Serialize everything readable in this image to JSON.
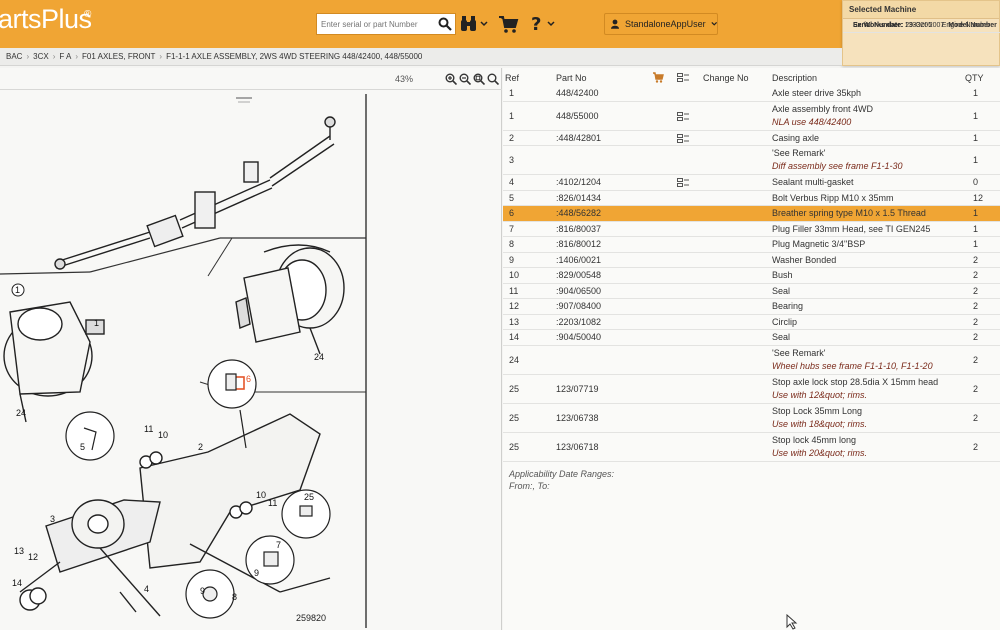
{
  "header": {
    "logo": "artsPlus",
    "search_placeholder": "Enter serial or part Number",
    "user_name": "StandaloneAppUser"
  },
  "machine": {
    "title": "Selected Machine",
    "serial_label": "Serial Number:",
    "serial_value": "1333205",
    "engine_label": "Engine Number",
    "works_label": "Ex Works date:",
    "works_value": "29-Oct-2007",
    "model_label": "Model Number"
  },
  "breadcrumb": [
    "BAC",
    "3CX",
    "F A",
    "F01 AXLES, FRONT",
    "F1-1-1 AXLE ASSEMBLY, 2WS 4WD STEERING 448/42400, 448/55000"
  ],
  "drawing": {
    "zoom": "43%",
    "drawing_number": "259820",
    "callouts": [
      "1",
      "24",
      "24",
      "6",
      "5",
      "11",
      "10",
      "2",
      "3",
      "10",
      "11",
      "25",
      "7",
      "9",
      "4",
      "9",
      "8",
      "13",
      "12",
      "14",
      "1"
    ]
  },
  "table": {
    "headers": {
      "ref": "Ref",
      "part_no": "Part No",
      "change_no": "Change No",
      "description": "Description",
      "qty": "QTY"
    },
    "rows": [
      {
        "ref": "1",
        "part": "448/42400",
        "desc": "Axle steer drive 35kph",
        "desc2": "",
        "qty": "1",
        "note": false,
        "sel": false
      },
      {
        "ref": "1",
        "part": "448/55000",
        "desc": "Axle assembly front 4WD",
        "desc2": "NLA use 448/42400",
        "qty": "1",
        "note": true,
        "sel": false
      },
      {
        "ref": "2",
        "part": ":448/42801",
        "desc": "Casing axle",
        "desc2": "",
        "qty": "1",
        "note": true,
        "sel": false
      },
      {
        "ref": "3",
        "part": "",
        "desc": "'See Remark'",
        "desc2": "Diff assembly see frame F1-1-30",
        "qty": "1",
        "note": false,
        "sel": false
      },
      {
        "ref": "4",
        "part": ":4102/1204",
        "desc": "Sealant multi-gasket",
        "desc2": "",
        "qty": "0",
        "note": true,
        "sel": false
      },
      {
        "ref": "5",
        "part": ":826/01434",
        "desc": "Bolt Verbus Ripp M10 x 35mm",
        "desc2": "",
        "qty": "12",
        "note": false,
        "sel": false
      },
      {
        "ref": "6",
        "part": ":448/56282",
        "desc": "Breather spring type M10 x 1.5 Thread",
        "desc2": "",
        "qty": "1",
        "note": false,
        "sel": true
      },
      {
        "ref": "7",
        "part": ":816/80037",
        "desc": "Plug Filler 33mm Head, see TI GEN245",
        "desc2": "",
        "qty": "1",
        "note": false,
        "sel": false
      },
      {
        "ref": "8",
        "part": ":816/80012",
        "desc": "Plug Magnetic 3/4\"BSP",
        "desc2": "",
        "qty": "1",
        "note": false,
        "sel": false
      },
      {
        "ref": "9",
        "part": ":1406/0021",
        "desc": "Washer Bonded",
        "desc2": "",
        "qty": "2",
        "note": false,
        "sel": false
      },
      {
        "ref": "10",
        "part": ":829/00548",
        "desc": "Bush",
        "desc2": "",
        "qty": "2",
        "note": false,
        "sel": false
      },
      {
        "ref": "11",
        "part": ":904/06500",
        "desc": "Seal",
        "desc2": "",
        "qty": "2",
        "note": false,
        "sel": false
      },
      {
        "ref": "12",
        "part": ":907/08400",
        "desc": "Bearing",
        "desc2": "",
        "qty": "2",
        "note": false,
        "sel": false
      },
      {
        "ref": "13",
        "part": ":2203/1082",
        "desc": "Circlip",
        "desc2": "",
        "qty": "2",
        "note": false,
        "sel": false
      },
      {
        "ref": "14",
        "part": ":904/50040",
        "desc": "Seal",
        "desc2": "",
        "qty": "2",
        "note": false,
        "sel": false
      },
      {
        "ref": "24",
        "part": "",
        "desc": "'See Remark'",
        "desc2": "Wheel hubs see frame F1-1-10, F1-1-20",
        "qty": "2",
        "note": false,
        "sel": false
      },
      {
        "ref": "25",
        "part": "123/07719",
        "desc": "Stop axle lock stop 28.5dia X 15mm head",
        "desc2": "Use with 12&quot; rims.",
        "qty": "2",
        "note": false,
        "sel": false
      },
      {
        "ref": "25",
        "part": "123/06738",
        "desc": "Stop Lock 35mm Long",
        "desc2": "Use with 18&quot; rims.",
        "qty": "2",
        "note": false,
        "sel": false
      },
      {
        "ref": "25",
        "part": "123/06718",
        "desc": "Stop lock 45mm long",
        "desc2": "Use with 20&quot; rims.",
        "qty": "2",
        "note": false,
        "sel": false
      }
    ],
    "applicability_title": "Applicability Date Ranges:",
    "applicability_value": "From:, To:"
  },
  "colors": {
    "accent": "#f0a534",
    "selected_row": "#f0a534"
  }
}
